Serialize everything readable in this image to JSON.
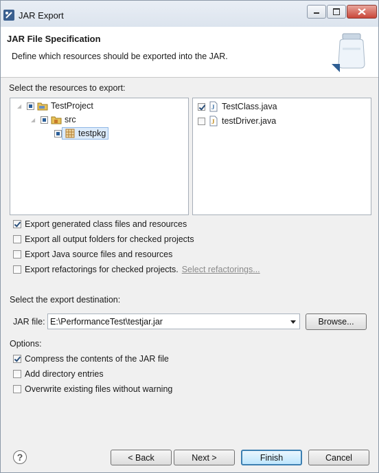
{
  "window": {
    "title": "JAR Export"
  },
  "header": {
    "title": "JAR File Specification",
    "description": "Define which resources should be exported into the JAR."
  },
  "resources": {
    "label": "Select the resources to export:",
    "tree": [
      {
        "label": "TestProject",
        "state": "partial",
        "icon": "project-icon"
      },
      {
        "label": "src",
        "state": "partial",
        "icon": "source-folder-icon"
      },
      {
        "label": "testpkg",
        "state": "partial",
        "icon": "package-icon",
        "selected": true
      }
    ],
    "files": [
      {
        "label": "TestClass.java",
        "checked": true,
        "icon": "java-file-icon"
      },
      {
        "label": "testDriver.java",
        "checked": false,
        "icon": "java-file-icon"
      }
    ]
  },
  "export_options": [
    {
      "label": "Export generated class files and resources",
      "checked": true
    },
    {
      "label": "Export all output folders for checked projects",
      "checked": false
    },
    {
      "label": "Export Java source files and resources",
      "checked": false
    },
    {
      "label": "Export refactorings for checked projects.",
      "checked": false
    }
  ],
  "select_refactorings_link": "Select refactorings...",
  "destination": {
    "label": "Select the export destination:",
    "jar_file_label": "JAR file:",
    "jar_file_value": "E:\\PerformanceTest\\testjar.jar",
    "browse_label": "Browse..."
  },
  "options": {
    "label": "Options:",
    "items": [
      {
        "label": "Compress the contents of the JAR file",
        "checked": true
      },
      {
        "label": "Add directory entries",
        "checked": false
      },
      {
        "label": "Overwrite existing files without warning",
        "checked": false
      }
    ]
  },
  "buttons": {
    "back": "< Back",
    "next": "Next >",
    "finish": "Finish",
    "cancel": "Cancel",
    "help": "?"
  },
  "colors": {
    "accent": "#3c7fb1",
    "selection": "#dcebfb"
  }
}
